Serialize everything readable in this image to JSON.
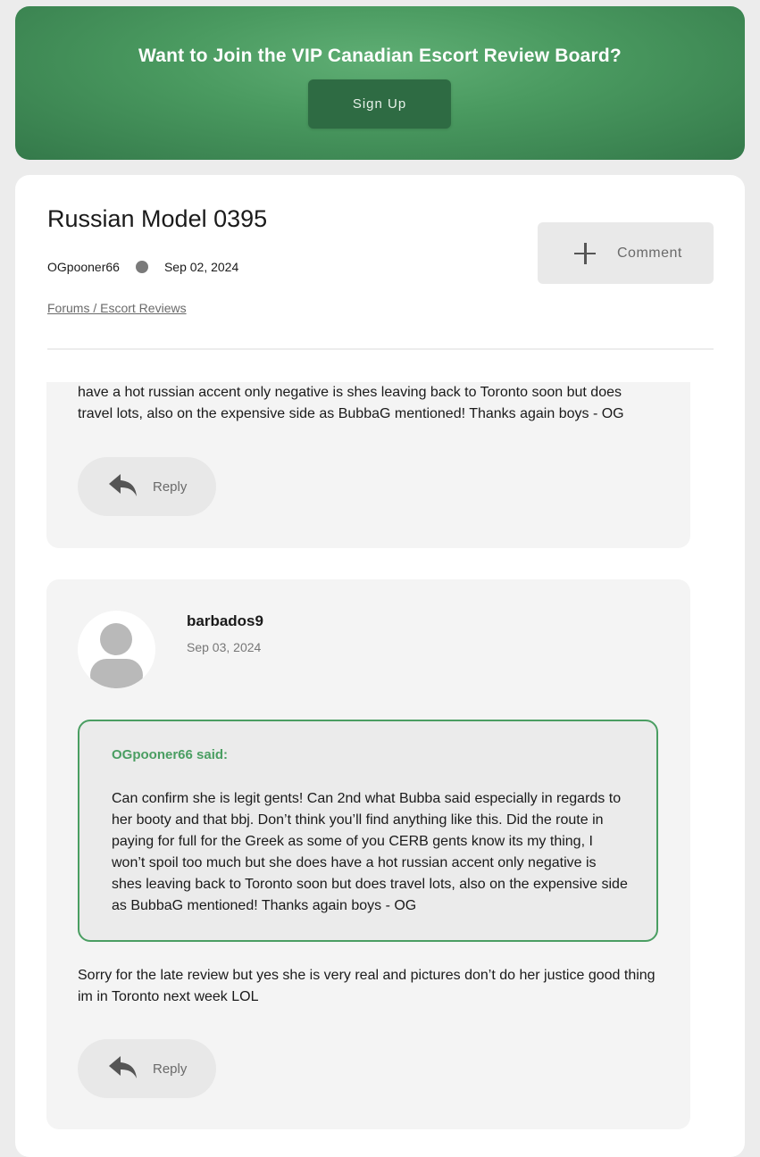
{
  "banner": {
    "title": "Want to Join the VIP Canadian Escort Review Board?",
    "signup_label": "Sign Up"
  },
  "post": {
    "title": "Russian Model 0395",
    "author": "OGpooner66",
    "date": "Sep 02, 2024",
    "breadcrumb": "Forums / Escort Reviews",
    "comment_label": "Comment"
  },
  "replies": [
    {
      "text": "have a hot russian accent only negative is shes leaving back to Toronto soon but does travel lots, also on the expensive side as BubbaG mentioned! Thanks again boys - OG",
      "reply_label": "Reply"
    },
    {
      "username": "barbados9",
      "date": "Sep 03, 2024",
      "quote": {
        "author": "OGpooner66 said:",
        "text": "Can confirm she is legit gents! Can 2nd what Bubba said especially in regards to her booty and that bbj. Don’t think you’ll find anything like this. Did the route in paying for full for the Greek as some of you CERB gents know its my thing, I won’t spoil too much but she does have a hot russian accent only negative is shes leaving back to Toronto soon but does travel lots, also on the expensive side as BubbaG mentioned! Thanks again boys - OG"
      },
      "text": "Sorry for the late review but yes she is very real and pictures don’t do her justice good thing im in Toronto next week LOL",
      "reply_label": "Reply"
    }
  ],
  "icons": {
    "comment": "plus-icon",
    "reply": "reply-arrow-icon",
    "avatar": "user-avatar-icon"
  },
  "colors": {
    "banner_green": "#4a9a60",
    "signup_button": "#2e6b43",
    "quote_accent": "#4a9e62"
  }
}
